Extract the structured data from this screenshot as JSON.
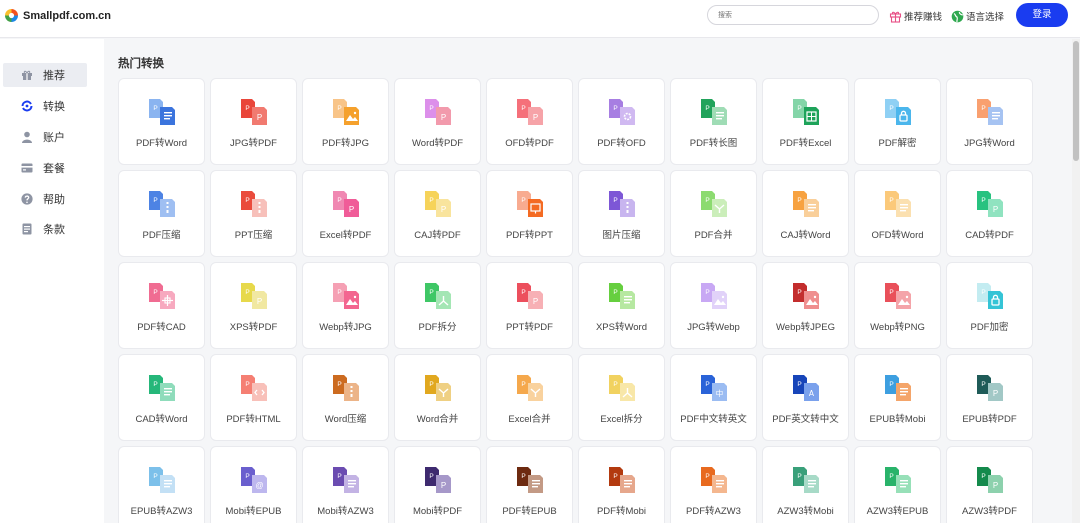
{
  "header": {
    "logo_text": "Smallpdf.com.cn",
    "search_placeholder": "搜索",
    "recommend_label": "推荐赚钱",
    "language_label": "语言选择",
    "login_label": "登录"
  },
  "sidebar": {
    "items": [
      {
        "label": "推荐",
        "icon": "gift-icon",
        "active": true
      },
      {
        "label": "转换",
        "icon": "convert-icon",
        "active": false
      },
      {
        "label": "账户",
        "icon": "user-icon",
        "active": false
      },
      {
        "label": "套餐",
        "icon": "package-icon",
        "active": false
      },
      {
        "label": "帮助",
        "icon": "help-icon",
        "active": false
      },
      {
        "label": "条款",
        "icon": "terms-icon",
        "active": false
      }
    ]
  },
  "main": {
    "section_title": "热门转换",
    "tools": [
      {
        "label": "PDF转Word",
        "back": "#8ab4f0",
        "front": "#3b74dd",
        "glyph": "lines"
      },
      {
        "label": "JPG转PDF",
        "back": "#e9463a",
        "front": "#f17a70",
        "glyph": "P"
      },
      {
        "label": "PDF转JPG",
        "back": "#f8c488",
        "front": "#f5a12d",
        "glyph": "mountain"
      },
      {
        "label": "Word转PDF",
        "back": "#dc8fea",
        "front": "#f29aac",
        "glyph": "P"
      },
      {
        "label": "OFD转PDF",
        "back": "#f5707a",
        "front": "#f6a3a8",
        "glyph": "P"
      },
      {
        "label": "PDF转OFD",
        "back": "#a77ee2",
        "front": "#d0b9f1",
        "glyph": "gear"
      },
      {
        "label": "PDF转长图",
        "back": "#21a35b",
        "front": "#9fdcb5",
        "glyph": "lines"
      },
      {
        "label": "PDF转Excel",
        "back": "#84d5a8",
        "front": "#1ea35a",
        "glyph": "grid"
      },
      {
        "label": "PDF解密",
        "back": "#8fd0f4",
        "front": "#4bb6ec",
        "glyph": "lock"
      },
      {
        "label": "JPG转Word",
        "back": "#f9a070",
        "front": "#a6c3f2",
        "glyph": "lines"
      },
      {
        "label": "PDF压缩",
        "back": "#4d83e4",
        "front": "#9fbff2",
        "glyph": "zip"
      },
      {
        "label": "PPT压缩",
        "back": "#ea4b3c",
        "front": "#f7c0ba",
        "glyph": "zip"
      },
      {
        "label": "Excel转PDF",
        "back": "#f088b2",
        "front": "#f05c98",
        "glyph": "P"
      },
      {
        "label": "CAJ转PDF",
        "back": "#f6d35a",
        "front": "#f9e49d",
        "glyph": "P"
      },
      {
        "label": "PDF转PPT",
        "back": "#f8ab90",
        "front": "#f46b23",
        "glyph": "ppt"
      },
      {
        "label": "图片压缩",
        "back": "#7d57d6",
        "front": "#c8b5ef",
        "glyph": "zip"
      },
      {
        "label": "PDF合并",
        "back": "#8cdb70",
        "front": "#cbeeba",
        "glyph": "merge"
      },
      {
        "label": "CAJ转Word",
        "back": "#f7a240",
        "front": "#f9cf9a",
        "glyph": "lines"
      },
      {
        "label": "OFD转Word",
        "back": "#fbc97a",
        "front": "#fbe0b0",
        "glyph": "lines"
      },
      {
        "label": "CAD转PDF",
        "back": "#28c280",
        "front": "#90e3c0",
        "glyph": "P"
      },
      {
        "label": "PDF转CAD",
        "back": "#f06c92",
        "front": "#f7a9bf",
        "glyph": "cad"
      },
      {
        "label": "XPS转PDF",
        "back": "#e7d94b",
        "front": "#f1e8a1",
        "glyph": "P"
      },
      {
        "label": "Webp转JPG",
        "back": "#f5a0b4",
        "front": "#f36690",
        "glyph": "mountain"
      },
      {
        "label": "PDF拆分",
        "back": "#3fc766",
        "front": "#a4e6b4",
        "glyph": "split"
      },
      {
        "label": "PPT转PDF",
        "back": "#ec4f5d",
        "front": "#f7b0b5",
        "glyph": "P"
      },
      {
        "label": "XPS转Word",
        "back": "#66cf3f",
        "front": "#b6e8a1",
        "glyph": "lines"
      },
      {
        "label": "JPG转Webp",
        "back": "#c8a8f4",
        "front": "#e1d2f9",
        "glyph": "mountain"
      },
      {
        "label": "Webp转JPEG",
        "back": "#c32d2d",
        "front": "#ef8f8f",
        "glyph": "mountain"
      },
      {
        "label": "Webp转PNG",
        "back": "#e9505a",
        "front": "#f4a4a9",
        "glyph": "mountain"
      },
      {
        "label": "PDF加密",
        "back": "#c3ecf1",
        "front": "#35c4d6",
        "glyph": "lock"
      },
      {
        "label": "CAD转Word",
        "back": "#26b77a",
        "front": "#8fdcbb",
        "glyph": "lines"
      },
      {
        "label": "PDF转HTML",
        "back": "#f57f73",
        "front": "#f8c0b9",
        "glyph": "code"
      },
      {
        "label": "Word压缩",
        "back": "#cc6b20",
        "front": "#ecb488",
        "glyph": "zip"
      },
      {
        "label": "Word合并",
        "back": "#e1a81f",
        "front": "#efd083",
        "glyph": "merge"
      },
      {
        "label": "Excel合并",
        "back": "#f5a84c",
        "front": "#f9d29e",
        "glyph": "merge"
      },
      {
        "label": "Excel拆分",
        "back": "#f1d260",
        "front": "#f8e7a8",
        "glyph": "split"
      },
      {
        "label": "PDF中文转英文",
        "back": "#2a63d8",
        "front": "#9bbcf2",
        "glyph": "中"
      },
      {
        "label": "PDF英文转中文",
        "back": "#1745b9",
        "front": "#7aa1ec",
        "glyph": "A"
      },
      {
        "label": "EPUB转Mobi",
        "back": "#3d9fe0",
        "front": "#f4a56a",
        "glyph": "lines"
      },
      {
        "label": "EPUB转PDF",
        "back": "#1f5b58",
        "front": "#a2c8c6",
        "glyph": "P"
      },
      {
        "label": "EPUB转AZW3",
        "back": "#7cc0ea",
        "front": "#c3e0f5",
        "glyph": "lines"
      },
      {
        "label": "Mobi转EPUB",
        "back": "#6a5fce",
        "front": "#bdb7ee",
        "glyph": "@"
      },
      {
        "label": "Mobi转AZW3",
        "back": "#6b4cb1",
        "front": "#c3b3e4",
        "glyph": "lines"
      },
      {
        "label": "Mobi转PDF",
        "back": "#3e2a6f",
        "front": "#a698c9",
        "glyph": "P"
      },
      {
        "label": "PDF转EPUB",
        "back": "#6d2a10",
        "front": "#c39a85",
        "glyph": "lines"
      },
      {
        "label": "PDF转Mobi",
        "back": "#b33a0f",
        "front": "#e6a78c",
        "glyph": "lines"
      },
      {
        "label": "PDF转AZW3",
        "back": "#e86a1f",
        "front": "#f4b78f",
        "glyph": "lines"
      },
      {
        "label": "AZW3转Mobi",
        "back": "#39a07a",
        "front": "#a7dac7",
        "glyph": "lines"
      },
      {
        "label": "AZW3转EPUB",
        "back": "#29b36a",
        "front": "#97e0b8",
        "glyph": "lines"
      },
      {
        "label": "AZW3转PDF",
        "back": "#148a4c",
        "front": "#8dd1ad",
        "glyph": "P"
      }
    ]
  },
  "colors": {
    "primary": "#1a3cf0",
    "active_nav_bg": "#ebedf2",
    "page_bg": "#f5f6f8"
  }
}
